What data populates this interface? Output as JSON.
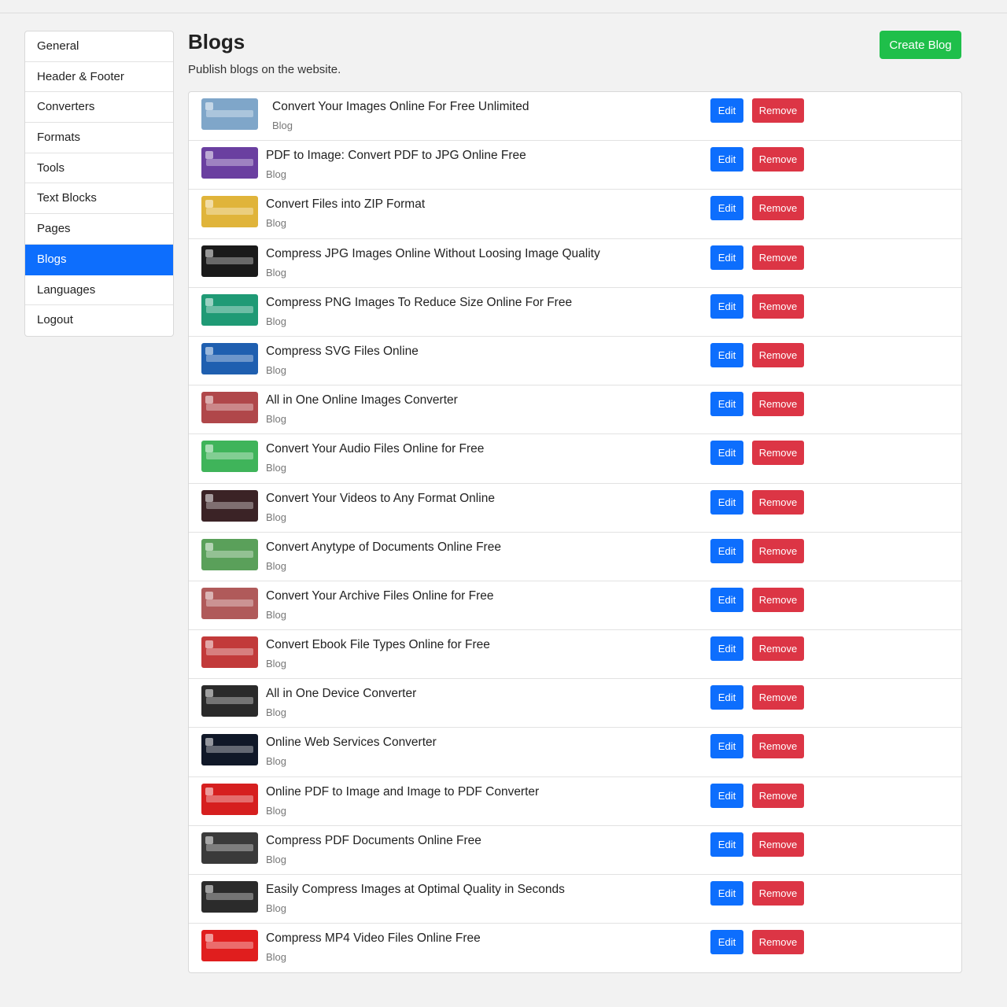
{
  "sidebar": {
    "items": [
      {
        "label": "General",
        "active": false
      },
      {
        "label": "Header & Footer",
        "active": false
      },
      {
        "label": "Converters",
        "active": false
      },
      {
        "label": "Formats",
        "active": false
      },
      {
        "label": "Tools",
        "active": false
      },
      {
        "label": "Text Blocks",
        "active": false
      },
      {
        "label": "Pages",
        "active": false
      },
      {
        "label": "Blogs",
        "active": true
      },
      {
        "label": "Languages",
        "active": false
      },
      {
        "label": "Logout",
        "active": false
      }
    ]
  },
  "header": {
    "title": "Blogs",
    "subtitle": "Publish blogs on the website.",
    "create_label": "Create Blog"
  },
  "actions": {
    "edit_label": "Edit",
    "remove_label": "Remove"
  },
  "colors": {
    "primary": "#0d6efd",
    "danger": "#dc3545",
    "success": "#1fbf4a"
  },
  "blogs": [
    {
      "title": "Convert Your Images Online For Free Unlimited",
      "tag": "Blog",
      "thumb_color": "#7fa6c9"
    },
    {
      "title": "PDF to Image: Convert PDF to JPG Online Free",
      "tag": "Blog",
      "thumb_color": "#6a3fa0"
    },
    {
      "title": "Convert Files into ZIP Format",
      "tag": "Blog",
      "thumb_color": "#e0b43a"
    },
    {
      "title": "Compress JPG Images Online Without Loosing Image Quality",
      "tag": "Blog",
      "thumb_color": "#1a1a1a"
    },
    {
      "title": "Compress PNG Images To Reduce Size Online For Free",
      "tag": "Blog",
      "thumb_color": "#1f9a75"
    },
    {
      "title": "Compress SVG Files Online",
      "tag": "Blog",
      "thumb_color": "#1f5fb0"
    },
    {
      "title": "All in One Online Images Converter",
      "tag": "Blog",
      "thumb_color": "#b0474a"
    },
    {
      "title": "Convert Your Audio Files Online for Free",
      "tag": "Blog",
      "thumb_color": "#3fb45a"
    },
    {
      "title": "Convert Your Videos to Any Format Online",
      "tag": "Blog",
      "thumb_color": "#3b2326"
    },
    {
      "title": "Convert Anytype of Documents Online Free",
      "tag": "Blog",
      "thumb_color": "#5aa05a"
    },
    {
      "title": "Convert Your Archive Files Online for Free",
      "tag": "Blog",
      "thumb_color": "#b05a5a"
    },
    {
      "title": "Convert Ebook File Types Online for Free",
      "tag": "Blog",
      "thumb_color": "#c23a3a"
    },
    {
      "title": "All in One Device Converter",
      "tag": "Blog",
      "thumb_color": "#2a2a2a"
    },
    {
      "title": "Online Web Services Converter",
      "tag": "Blog",
      "thumb_color": "#101828"
    },
    {
      "title": "Online PDF to Image and Image to PDF Converter",
      "tag": "Blog",
      "thumb_color": "#d61f1f"
    },
    {
      "title": "Compress PDF Documents Online Free",
      "tag": "Blog",
      "thumb_color": "#3a3a3a"
    },
    {
      "title": "Easily Compress Images at Optimal Quality in Seconds",
      "tag": "Blog",
      "thumb_color": "#2b2b2b"
    },
    {
      "title": "Compress MP4 Video Files Online Free",
      "tag": "Blog",
      "thumb_color": "#e01e1e"
    }
  ]
}
